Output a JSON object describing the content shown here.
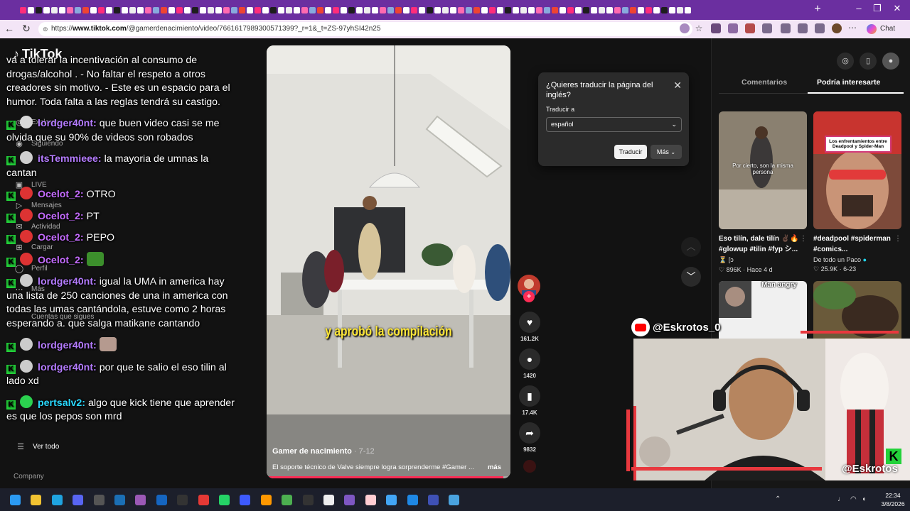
{
  "browser": {
    "url_prefix": "https://",
    "url_domain": "www.tiktok.com",
    "url_path": "/@gamerdenacimiento/video/7661617989300571399?_r=1&_t=ZS-97yhSI42n25",
    "chat_label": "Chat",
    "new_tab": "+",
    "colors": {
      "tabstrip": "#6b2fa0",
      "addressbar": "#f3e5f6"
    }
  },
  "tiktok": {
    "logo": "TikTok",
    "sidebar": [
      {
        "label": "Explorar",
        "icon": "compass-icon"
      },
      {
        "label": "Siguiendo",
        "icon": "following-icon"
      },
      {
        "label": "LIVE",
        "icon": "live-icon"
      },
      {
        "label": "Mensajes",
        "icon": "message-icon"
      },
      {
        "label": "Actividad",
        "icon": "activity-icon"
      },
      {
        "label": "Cargar",
        "icon": "upload-icon"
      },
      {
        "label": "Perfil",
        "icon": "profile-icon"
      },
      {
        "label": "Más",
        "icon": "more-icon"
      },
      {
        "label": "Cuentas que sigues",
        "icon": ""
      },
      {
        "label": "Ver todo",
        "icon": "list-icon"
      }
    ],
    "company": "Company"
  },
  "chat": {
    "first_line": "va a tolerar la incentivación al consumo de drogas/alcohol . - No faltar el respeto a otros creadores sin motivo. - Este es un espacio para el humor. Toda falta a las reglas tendrá su castigo.",
    "messages": [
      {
        "user": "lordger40nt:",
        "text": "que buen video casi se me olvida que su 90% de videos son robados",
        "color": "#b57cff"
      },
      {
        "user": "itsTemmieee:",
        "text": "la mayoria de umnas la cantan",
        "color": "#b57cff"
      },
      {
        "user": "Ocelot_2:",
        "text": "OTRO",
        "color": "#c56cff"
      },
      {
        "user": "Ocelot_2:",
        "text": "PT",
        "color": "#c56cff"
      },
      {
        "user": "Ocelot_2:",
        "text": "PEPO",
        "color": "#c56cff"
      },
      {
        "user": "Ocelot_2:",
        "text": "",
        "color": "#c56cff",
        "emote": "green-frog-emote"
      },
      {
        "user": "lordger40nt:",
        "text": "igual la UMA in america hay una lista de 250 canciones de una in america con todas las umas cantándola, estuve como 2 horas esperando a. que salga matikane cantando",
        "color": "#b57cff"
      },
      {
        "user": "lordger40nt:",
        "text": "",
        "color": "#b57cff",
        "emote": "cat-emote"
      },
      {
        "user": "lordger40nt:",
        "text": "por que te salio el eso tilin al lado xd",
        "color": "#b57cff"
      },
      {
        "user": "pertsalv2:",
        "text": "algo que kick tiene que aprender es que los pepos son mrd",
        "color": "#29d8ff"
      }
    ]
  },
  "video": {
    "subtitle": "y aprobó la compilación",
    "author": "Gamer de nacimiento",
    "date": "· 7-12",
    "description": "El soporte técnico de Valve siempre logra sorprenderme #Gamer ...",
    "more": "más",
    "progress": 0.97,
    "likes": "161.2K",
    "comments": "1420",
    "saves": "17.4K",
    "shares": "9832"
  },
  "translate_popup": {
    "title": "¿Quieres traducir la página del inglés?",
    "label": "Traducir a",
    "selected": "español",
    "translate_btn": "Traducir",
    "more_btn": "Más"
  },
  "right_panel": {
    "tabs": [
      "Comentarios",
      "Podría interesarte"
    ],
    "active_tab": 1,
    "cards": [
      {
        "title": "Eso tilín, dale tilín ✌🏿🔥 #glowup #tilin #fyp シ...",
        "author": "⏳ [ɔ",
        "likes": "896K",
        "age": "Hace 4 d",
        "overlay": "Por cierto, son la misma persona"
      },
      {
        "title": "#deadpool #spiderman #comics...",
        "author": "De todo un Paco",
        "likes": "25.9K",
        "age": "6-23",
        "overlay": "Los enfrentamientos entre Deadpool y Spider-Man"
      },
      {
        "overlay": "Man angry"
      },
      {
        "overlay": ""
      }
    ]
  },
  "stream_overlay": {
    "youtube_name": "@Eskrotos_0",
    "kick_name": "@Eskrotos",
    "accent": "#e8383e"
  },
  "taskbar": {
    "time": "22:34",
    "date": "3/8/2026"
  }
}
